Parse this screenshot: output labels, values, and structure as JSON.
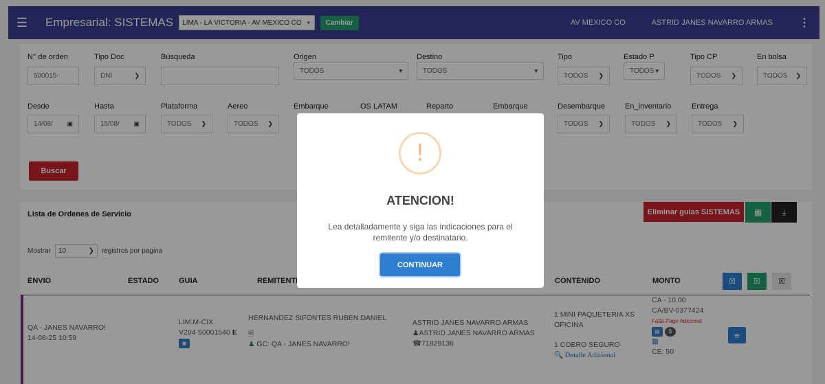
{
  "navbar": {
    "title": "Empresarial: SISTEMAS",
    "branch": "LIMA - LA VICTORIA - AV MEXICO CO",
    "cambiar": "Cambiar",
    "location": "AV MEXICO CO",
    "user": "ASTRID JANES NAVARRO ARMAS"
  },
  "filters": {
    "orden_label": "N° de orden",
    "orden_value": "500015-",
    "tipodoc_label": "Tipo Doc",
    "tipodoc_value": "DNI",
    "busqueda_label": "Búsqueda",
    "origen_label": "Origen",
    "origen_value": "TODOS",
    "destino_label": "Destino",
    "destino_value": "TODOS",
    "tipo_label": "Tipo",
    "tipo_value": "TODOS",
    "estadop_label": "Estado P",
    "estadop_value": "TODOS",
    "tipocp_label": "Tipo CP",
    "tipocp_value": "TODOS",
    "enbolsa_label": "En bolsa",
    "enbolsa_value": "TODOS",
    "desde_label": "Desde",
    "desde_value": "14/08/",
    "hasta_label": "Hasta",
    "hasta_value": "15/08/",
    "plataforma_label": "Plataforma",
    "plataforma_value": "TODOS",
    "aereo_label": "Aereo",
    "aereo_value": "TODOS",
    "embarque_label": "Embarque",
    "oslatam_label": "OS LATAM",
    "reparto_label": "Reparto",
    "embarque2_label": "Embarque",
    "desembarque_label": "Desembarque",
    "desembarque_value": "TODOS",
    "eninv_label": "En_inventario",
    "eninv_value": "TODOS",
    "entrega_label": "Entrega",
    "entrega_value": "TODOS",
    "buscar": "Buscar"
  },
  "list": {
    "title": "Lista de Ordenes de Servicio",
    "eliminar": "Eliminar guias SISTEMAS",
    "mostrar": "Mostrar",
    "page_size": "10",
    "registros": "registros por pagina",
    "headers": {
      "envio": "ENVIO",
      "estado": "ESTADO",
      "guia": "GUIA",
      "remitente": "REMITENTE",
      "contenido": "CONTENIDO",
      "monto": "MONTO"
    },
    "row": {
      "envio_name": "QA - JANES NAVARRO!",
      "envio_date": "14-08-25 10:59",
      "guia_1": "LIM.M-CIX",
      "guia_2": "V204-50001540",
      "guia_mark": "E",
      "remitente": "HERNANDEZ SIFONTES RUBEN DANIEL",
      "gc": "GC: QA - JANES NAVARRO!",
      "dest_name": "ASTRID JANES NAVARRO ARMAS",
      "dest_user": "ASTRID JANES NAVARRO ARMAS",
      "dest_phone": "71829136",
      "contenido_1": "1 MINI PAQUETERIA XS",
      "contenido_2": "OFICINA",
      "contenido_3": "1 COBRO SEGURO",
      "detalle": "Detalle Adicional",
      "monto_1": "CA - 10.00",
      "monto_2": "CA/BV-0377424",
      "falta_pago": "Falta Pago Adicional",
      "ce": "CE: 50"
    }
  },
  "modal": {
    "icon": "!",
    "title": "ATENCION!",
    "text": "Lea detalladamente y siga las indicaciones para el remitente y/o destinatario.",
    "button": "CONTINUAR"
  }
}
